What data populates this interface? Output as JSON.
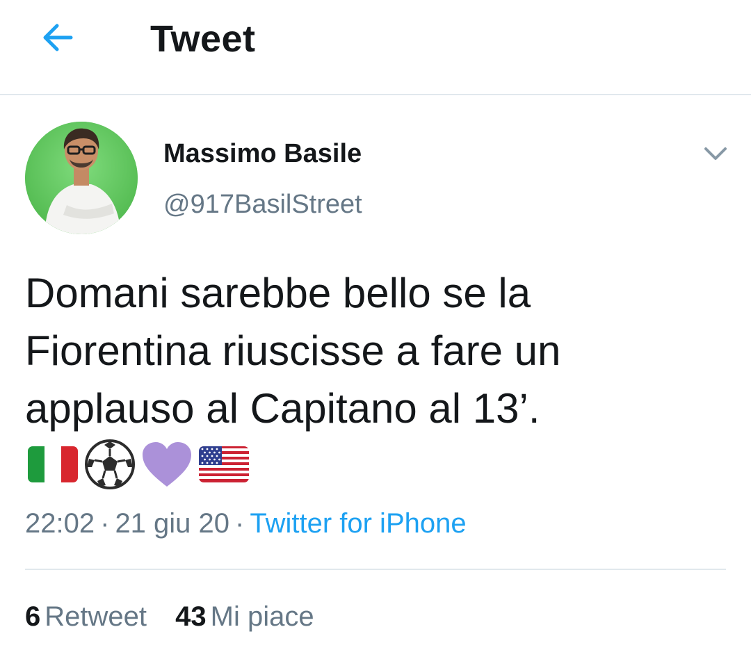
{
  "header": {
    "back_icon": "arrow-left-icon",
    "title": "Tweet",
    "accent_color": "#1da1f2"
  },
  "tweet": {
    "author": {
      "name": "Massimo Basile",
      "handle": "@917BasilStreet",
      "avatar_icon": "user-avatar"
    },
    "more_icon": "chevron-down-icon",
    "text": "Domani sarebbe bello se la\nFiorentina riuscisse a fare un\napplauso al Capitano al 13’.",
    "emojis": [
      "italy-flag-icon",
      "soccer-ball-icon",
      "purple-heart-icon",
      "us-flag-icon"
    ],
    "time": "22:02",
    "date": "21 giu 20",
    "separator": "·",
    "source": "Twitter for iPhone"
  },
  "stats": {
    "retweets_count": "6",
    "retweets_label": "Retweet",
    "likes_count": "43",
    "likes_label": "Mi piace"
  }
}
